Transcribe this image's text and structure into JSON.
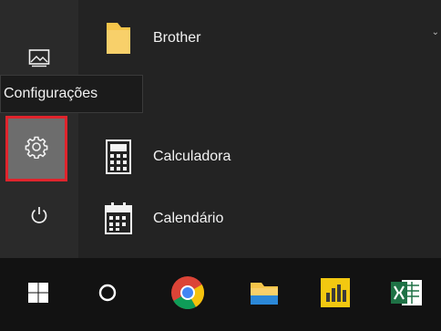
{
  "tooltip": {
    "text": "Configurações"
  },
  "rail": {
    "items": [
      {
        "name": "Fotos",
        "icon": "photos-icon"
      },
      {
        "name": "Configurações",
        "icon": "gear-icon",
        "highlight": "#e0242c"
      },
      {
        "name": "Energia",
        "icon": "power-icon"
      }
    ]
  },
  "apps": [
    {
      "label": "Brother",
      "icon": "folder-icon"
    },
    {
      "label": "Calculadora",
      "icon": "calculator-icon"
    },
    {
      "label": "Calendário",
      "icon": "calendar-icon"
    }
  ],
  "taskbar": {
    "items": [
      {
        "icon": "windows-start-icon"
      },
      {
        "icon": "cortana-search-icon"
      },
      {
        "icon": "chrome-icon"
      },
      {
        "icon": "file-explorer-icon"
      },
      {
        "icon": "power-bi-icon"
      },
      {
        "icon": "excel-icon"
      }
    ]
  },
  "colors": {
    "highlight": "#e0242c",
    "folder": "#f5c54a",
    "excel": "#1e7145"
  }
}
